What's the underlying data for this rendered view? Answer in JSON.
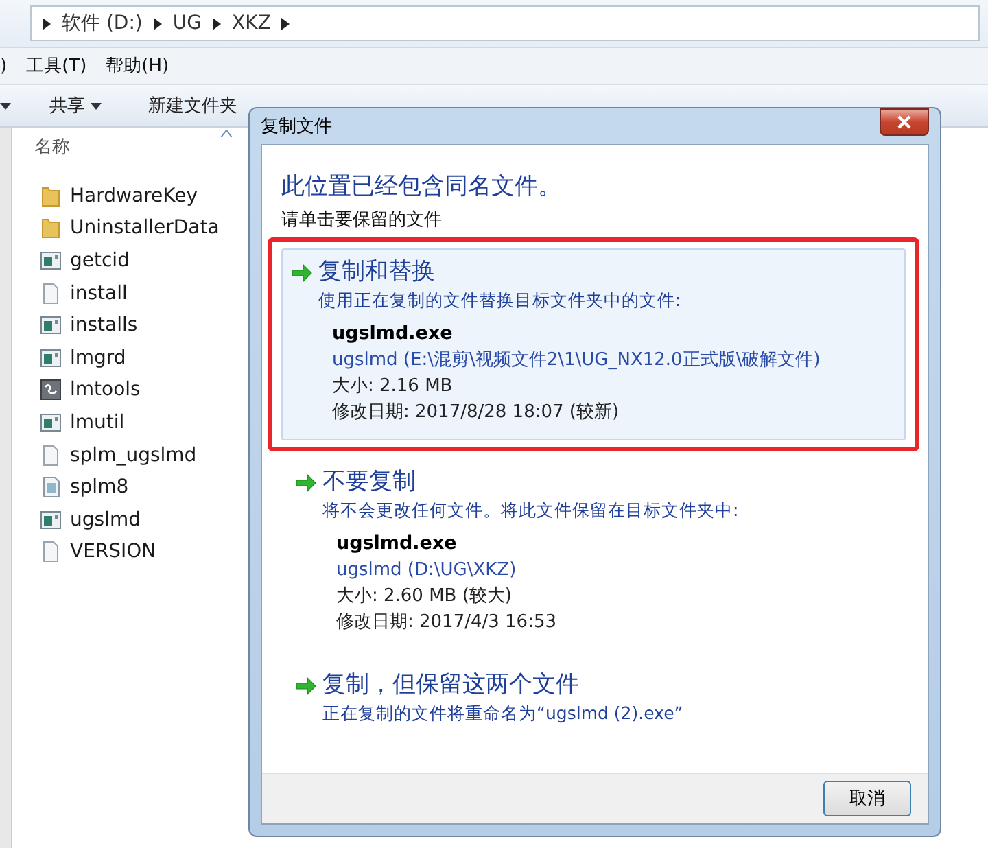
{
  "explorer": {
    "breadcrumb": [
      "软件 (D:)",
      "UG",
      "XKZ"
    ],
    "menu": [
      ")",
      "工具(T)",
      "帮助(H)"
    ],
    "toolbar": [
      {
        "label": "共享",
        "dropdown": true
      },
      {
        "label": "新建文件夹",
        "dropdown": false
      }
    ],
    "column_header": "名称",
    "files": [
      {
        "name": "HardwareKey",
        "kind": "folder"
      },
      {
        "name": "UninstallerData",
        "kind": "folder"
      },
      {
        "name": "getcid",
        "kind": "app"
      },
      {
        "name": "install",
        "kind": "document"
      },
      {
        "name": "installs",
        "kind": "app"
      },
      {
        "name": "lmgrd",
        "kind": "app"
      },
      {
        "name": "lmtools",
        "kind": "tool"
      },
      {
        "name": "lmutil",
        "kind": "app"
      },
      {
        "name": "splm_ugslmd",
        "kind": "document"
      },
      {
        "name": "splm8",
        "kind": "config"
      },
      {
        "name": "ugslmd",
        "kind": "app"
      },
      {
        "name": "VERSION",
        "kind": "document"
      }
    ]
  },
  "dialog": {
    "title": "复制文件",
    "heading": "此位置已经包含同名文件。",
    "instruction": "请单击要保留的文件",
    "options": [
      {
        "title": "复制和替换",
        "description": "使用正在复制的文件替换目标文件夹中的文件:",
        "hovered": true,
        "outlined": true,
        "file": {
          "name": "ugslmd.exe",
          "location": "ugslmd (E:\\混剪\\视频文件2\\1\\UG_NX12.0正式版\\破解文件)",
          "size": "大小: 2.16 MB",
          "modified": "修改日期: 2017/8/28 18:07 (较新)"
        }
      },
      {
        "title": "不要复制",
        "description": "将不会更改任何文件。将此文件保留在目标文件夹中:",
        "hovered": false,
        "outlined": false,
        "file": {
          "name": "ugslmd.exe",
          "location": "ugslmd (D:\\UG\\XKZ)",
          "size": "大小: 2.60 MB (较大)",
          "modified": "修改日期: 2017/4/3 16:53"
        }
      },
      {
        "title": "复制，但保留这两个文件",
        "description": "正在复制的文件将重命名为“ugslmd (2).exe”",
        "hovered": false,
        "outlined": false
      }
    ],
    "cancel_button": "取消"
  }
}
